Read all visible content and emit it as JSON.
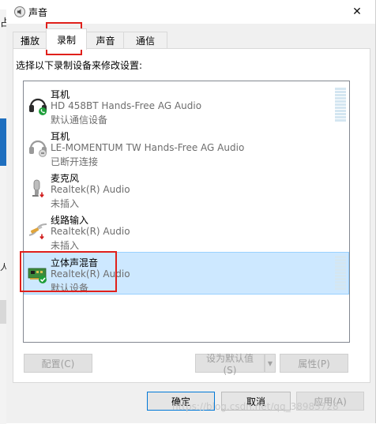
{
  "window": {
    "title": "声音",
    "close_glyph": "✕",
    "icon": "speaker-icon"
  },
  "background_window": {
    "glyphs": [
      "占",
      "人"
    ]
  },
  "tabs": [
    {
      "label": "播放",
      "active": false
    },
    {
      "label": "录制",
      "active": true
    },
    {
      "label": "声音",
      "active": false
    },
    {
      "label": "通信",
      "active": false
    }
  ],
  "instructions": "选择以下录制设备来修改设置:",
  "devices": [
    {
      "name": "耳机",
      "driver": "HD 458BT Hands-Free AG Audio",
      "status": "默认通信设备",
      "icon": "headset-icon",
      "badge": "phone-badge-icon",
      "selected": false,
      "meter": true
    },
    {
      "name": "耳机",
      "driver": "LE-MOMENTUM TW Hands-Free AG Audio",
      "status": "已断开连接",
      "icon": "headset-icon",
      "badge": "disconnected-badge-icon",
      "selected": false,
      "meter": false
    },
    {
      "name": "麦克风",
      "driver": "Realtek(R) Audio",
      "status": "未插入",
      "icon": "microphone-icon",
      "badge": "unplugged-badge-icon",
      "selected": false,
      "meter": false
    },
    {
      "name": "线路输入",
      "driver": "Realtek(R) Audio",
      "status": "未插入",
      "icon": "line-in-icon",
      "badge": "unplugged-badge-icon",
      "selected": false,
      "meter": false
    },
    {
      "name": "立体声混音",
      "driver": "Realtek(R) Audio",
      "status": "默认设备",
      "icon": "sound-card-icon",
      "badge": "default-check-badge-icon",
      "selected": true,
      "meter": true
    }
  ],
  "buttons": {
    "configure": "配置(C)",
    "set_default": "设为默认值(S)",
    "set_default_arrow": "▼",
    "properties": "属性(P)",
    "ok": "确定",
    "cancel": "取消",
    "apply": "应用(A)"
  },
  "watermark": "https://blog.csdn.net/qq_38983728",
  "colors": {
    "annotation": "#e0201b",
    "selection": "#cde8ff",
    "primary_border": "#0078d7"
  }
}
